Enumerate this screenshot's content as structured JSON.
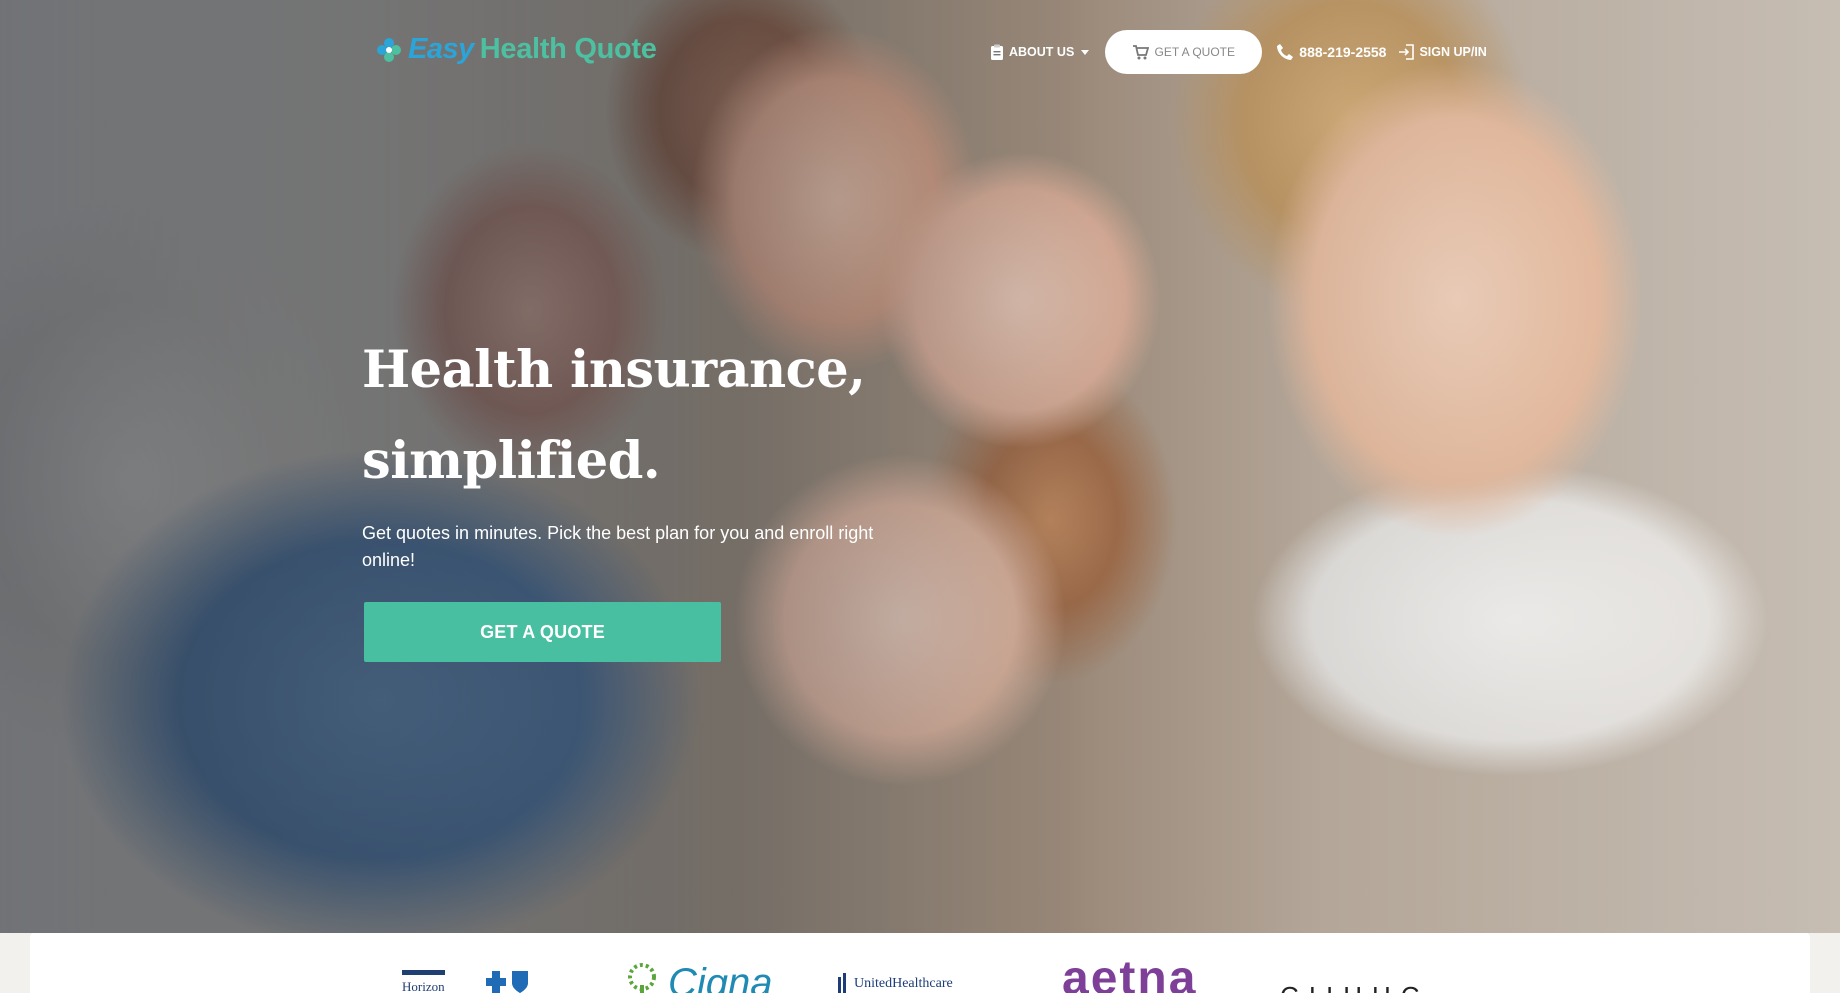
{
  "header": {
    "logo": {
      "easy": "Easy",
      "rest": "Health Quote"
    },
    "nav": {
      "about_label": "ABOUT US",
      "quote_label": "GET A QUOTE",
      "phone": "888-219-2558",
      "sign_label": "SIGN UP/IN"
    }
  },
  "hero": {
    "title_line1": "Health insurance,",
    "title_line2": "simplified.",
    "subtitle": "Get quotes in minutes. Pick the best plan for you and enroll right online!",
    "cta_label": "GET A QUOTE"
  },
  "insurers": {
    "horizon": "Horizon",
    "cigna": "Cigna",
    "uhc": "UnitedHealthcare",
    "aetna": "aetna",
    "ambetter": "CIIHHC"
  },
  "colors": {
    "brand_green": "#48bfa0",
    "brand_blue": "#2ba4d8",
    "aetna_purple": "#7d3f98",
    "cigna_blue": "#1f8ab3"
  },
  "icons": [
    "logo-flower-icon",
    "clipboard-icon",
    "cart-icon",
    "phone-icon",
    "sign-in-icon",
    "caret-down-icon"
  ]
}
